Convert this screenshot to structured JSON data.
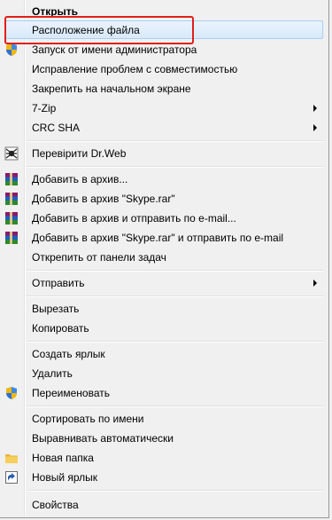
{
  "menu": {
    "items": [
      {
        "label": "Открыть",
        "bold": true,
        "icon": null
      },
      {
        "label": "Расположение файла",
        "icon": null,
        "highlighted": true
      },
      {
        "label": "Запуск от имени администратора",
        "icon": "uac-shield-icon"
      },
      {
        "label": "Исправление проблем с совместимостью",
        "icon": null
      },
      {
        "label": "Закрепить на начальном экране",
        "icon": null
      },
      {
        "label": "7-Zip",
        "icon": null,
        "submenu": true
      },
      {
        "label": "CRC SHA",
        "icon": null,
        "submenu": true
      },
      {
        "label": "Перевірити Dr.Web",
        "icon": "drweb-spider-icon"
      },
      {
        "label": "Добавить в архив...",
        "icon": "winrar-books-icon"
      },
      {
        "label": "Добавить в архив \"Skype.rar\"",
        "icon": "winrar-books-icon"
      },
      {
        "label": "Добавить в архив и отправить по e-mail...",
        "icon": "winrar-books-icon"
      },
      {
        "label": "Добавить в архив \"Skype.rar\" и отправить по e-mail",
        "icon": "winrar-books-icon"
      },
      {
        "label": "Открепить от панели задач",
        "icon": null
      },
      {
        "label": "Отправить",
        "icon": null,
        "submenu": true
      },
      {
        "label": "Вырезать",
        "icon": null
      },
      {
        "label": "Копировать",
        "icon": null
      },
      {
        "label": "Создать ярлык",
        "icon": null
      },
      {
        "label": "Удалить",
        "icon": null
      },
      {
        "label": "Переименовать",
        "icon": "uac-shield-icon"
      },
      {
        "label": "Сортировать по имени",
        "icon": null
      },
      {
        "label": "Выравнивать автоматически",
        "icon": null
      },
      {
        "label": "Новая папка",
        "icon": "folder-icon"
      },
      {
        "label": "Новый ярлык",
        "icon": "shortcut-arrow-icon"
      },
      {
        "label": "Свойства",
        "icon": null
      }
    ]
  },
  "colors": {
    "highlight_border": "#a9d0f4",
    "annotation_red": "#e0201a"
  }
}
